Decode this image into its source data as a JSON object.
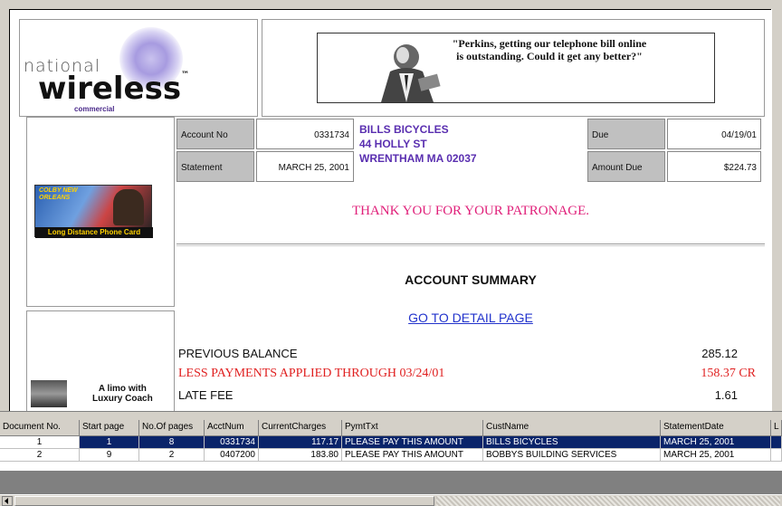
{
  "header": {
    "logo_national": "national",
    "logo_wireless": "wireless",
    "logo_tm": "™",
    "logo_commercial": "commercial",
    "quote": "\"Perkins, getting our telephone bill online is outstanding. Could it get any better?\""
  },
  "account": {
    "account_no_label": "Account No",
    "account_no": "0331734",
    "statement_label": "Statement",
    "statement_date": "MARCH 25, 2001",
    "name": "BILLS BICYCLES",
    "street": "44 HOLLY ST",
    "city": "WRENTHAM MA 02037",
    "due_label": "Due",
    "due_date": "04/19/01",
    "amount_due_label": "Amount Due",
    "amount_due": "$224.73"
  },
  "ads": {
    "phone_card_top": "COLBY NEW ORLEANS",
    "phone_card_caption": "Long Distance Phone Card",
    "limo_caption_1": "A limo with",
    "limo_caption_2": "Luxury Coach"
  },
  "message": "THANK YOU FOR YOUR PATRONAGE.",
  "summary": {
    "title": "ACCOUNT SUMMARY",
    "detail_link": "GO TO DETAIL PAGE",
    "rows": [
      {
        "label": "PREVIOUS BALANCE",
        "amount": "285.12"
      },
      {
        "label": "LESS PAYMENTS APPLIED THROUGH 03/24/01",
        "amount": "158.37 CR"
      },
      {
        "label": "LATE FEE",
        "amount": "1.61"
      }
    ]
  },
  "grid": {
    "columns": [
      "Document No.",
      "Start page",
      "No.Of pages",
      "AcctNum",
      "CurrentCharges",
      "PymtTxt",
      "CustName",
      "StatementDate",
      "L"
    ],
    "rows": [
      [
        "1",
        "1",
        "8",
        "0331734",
        "117.17",
        "PLEASE PAY THIS AMOUNT",
        "BILLS BICYCLES",
        "MARCH 25, 2001",
        ""
      ],
      [
        "2",
        "9",
        "2",
        "0407200",
        "183.80",
        "PLEASE PAY THIS AMOUNT",
        "BOBBYS BUILDING SERVICES",
        "MARCH 25, 2001",
        ""
      ]
    ]
  },
  "colors": {
    "address": "#5a2fb0",
    "thank_you": "#e0207a",
    "payments": "#e02020",
    "link": "#2233cc",
    "selection": "#0a246a"
  }
}
